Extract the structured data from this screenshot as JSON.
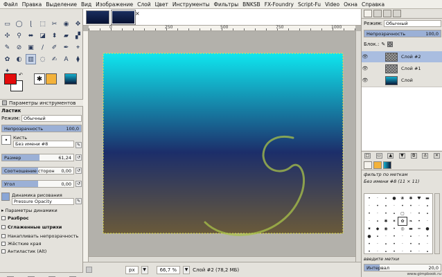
{
  "menubar": {
    "items": [
      "Файл",
      "Правка",
      "Выделение",
      "Вид",
      "Изображение",
      "Слой",
      "Цвет",
      "Инструменты",
      "Фильтры",
      "BNKSB",
      "FX-Foundry",
      "Script-Fu",
      "Video",
      "Окна",
      "Справка"
    ]
  },
  "toolbox": {
    "tools": [
      "▭",
      "◯",
      "ɭ",
      "⬚",
      "✂",
      "◉",
      "✥",
      "✣",
      "⚲",
      "⬌",
      "◪",
      "⬍",
      "▰",
      "▞",
      "✎",
      "⊘",
      "▣",
      "/",
      "✐",
      "✒",
      "⌖",
      "✿",
      "◐",
      "▥",
      "◌",
      "✍",
      "A",
      "⧫",
      "✦"
    ],
    "fg_color": "#e30b0b",
    "bg_color": "#ffffff",
    "swap_icon": "↶",
    "brush_icon": "✱"
  },
  "tool_options": {
    "tab_title": "Параметры инструментов",
    "tool_name": "Ластик",
    "mode_label": "Режим:",
    "mode_value": "Обычный",
    "opacity_label": "Непрозрачность",
    "opacity_value": "100,0",
    "opacity": 1.0,
    "brush_label": "Кисть",
    "brush_value": "Без имени #8",
    "size_label": "Размер",
    "size_value": "61,24",
    "size_fill": 0.52,
    "aspect_label": "Соотношение сторон",
    "aspect_value": "0,00",
    "aspect_fill": 0.5,
    "angle_label": "Угол",
    "angle_value": "0,00",
    "angle_fill": 0.5,
    "dynamics_label": "Динамика рисования",
    "dynamics_value": "Pressure Opacity",
    "dynamics_options_label": "Параметры динамики",
    "scatter_label": "Разброс",
    "smooth_label": "Сглаженные штрихи",
    "incremental_label": "Накапливать непрозрачность",
    "hard_label": "Жёсткие края",
    "antierase_label": "Антиластик (Alt)"
  },
  "image_window": {
    "ruler_marks": [
      "0",
      "250",
      "500",
      "750",
      "1000"
    ],
    "zoom_unit": "px",
    "zoom_value": "66,7 %",
    "status_text": "Слой #2 (78,2 МБ)",
    "close_icon": "×"
  },
  "canvas": {
    "gradient_top": "#0fe6ef",
    "gradient_mid": "#1c2e6a",
    "gradient_bottom": "#6a5a3a",
    "swirl_color": "#a8c24a"
  },
  "layers_dock": {
    "mode_label": "Режим:",
    "mode_value": "Обычный",
    "opacity_label": "Непрозрачность",
    "opacity_value": "100,0",
    "lock_label": "Блок.:",
    "layers": [
      {
        "name": "Слой #2",
        "selected": true
      },
      {
        "name": "Слой #1",
        "selected": false
      },
      {
        "name": "Слой",
        "selected": false
      }
    ]
  },
  "brushes_dock": {
    "filter_label": "фильтр по меткам",
    "brush_name": "Без имени #8 (11 × 11)",
    "tag_placeholder": "введите метки",
    "spacing_label": "Интервал",
    "spacing_value": "20,0",
    "spacing_fill": 0.2,
    "watermark": "www.gimpbook.ru"
  }
}
